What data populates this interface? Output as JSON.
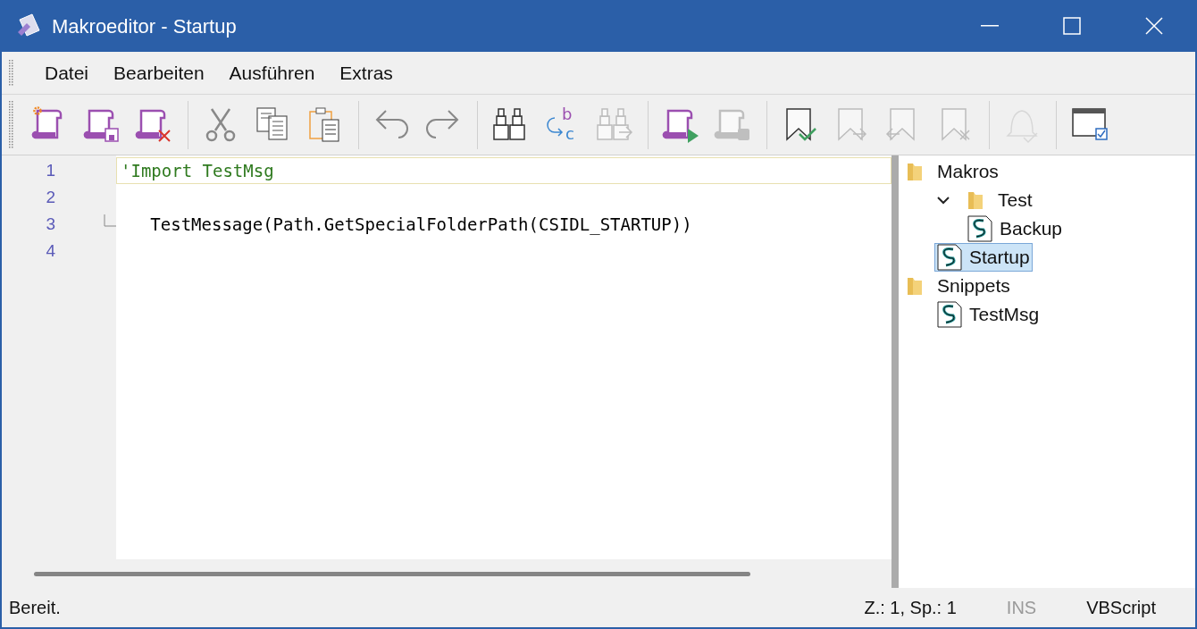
{
  "window": {
    "title": "Makroeditor - Startup"
  },
  "menu": [
    "Datei",
    "Bearbeiten",
    "Ausführen",
    "Extras"
  ],
  "toolbar": [
    {
      "kind": "new",
      "disabled": false
    },
    {
      "kind": "save",
      "disabled": false
    },
    {
      "kind": "delete",
      "disabled": false
    },
    {
      "kind": "sep"
    },
    {
      "kind": "cut",
      "disabled": false
    },
    {
      "kind": "copy",
      "disabled": false
    },
    {
      "kind": "paste",
      "disabled": false
    },
    {
      "kind": "sep"
    },
    {
      "kind": "undo",
      "disabled": false
    },
    {
      "kind": "redo",
      "disabled": false
    },
    {
      "kind": "sep"
    },
    {
      "kind": "find",
      "disabled": false
    },
    {
      "kind": "replace",
      "disabled": false,
      "letters": [
        "b",
        "c"
      ]
    },
    {
      "kind": "findnext",
      "disabled": true
    },
    {
      "kind": "sep"
    },
    {
      "kind": "run",
      "disabled": false
    },
    {
      "kind": "stop",
      "disabled": true
    },
    {
      "kind": "sep"
    },
    {
      "kind": "bookmark",
      "disabled": false
    },
    {
      "kind": "nextmark",
      "disabled": true
    },
    {
      "kind": "prevmark",
      "disabled": true
    },
    {
      "kind": "clearmarks",
      "disabled": true
    },
    {
      "kind": "sep"
    },
    {
      "kind": "bell",
      "disabled": true
    },
    {
      "kind": "sep"
    },
    {
      "kind": "window",
      "disabled": false
    }
  ],
  "editor": {
    "lines": [
      {
        "number": "1",
        "text": "'Import TestMsg",
        "kind": "comment",
        "current": true
      },
      {
        "number": "2"
      },
      {
        "number": "3",
        "text": "   TestMessage(Path.GetSpecialFolderPath(CSIDL_STARTUP))",
        "kind": "code",
        "fold_end": true
      },
      {
        "number": "4"
      }
    ]
  },
  "tree": [
    {
      "label": "Makros",
      "kind": "folder",
      "selected": false,
      "children": [
        {
          "label": "Test",
          "kind": "folder",
          "expanded": true,
          "selected": false,
          "children": [
            {
              "label": "Backup",
              "kind": "script",
              "selected": false
            }
          ]
        },
        {
          "label": "Startup",
          "kind": "script",
          "selected": true
        }
      ]
    },
    {
      "label": "Snippets",
      "kind": "folder",
      "selected": false,
      "children": [
        {
          "label": "TestMsg",
          "kind": "script",
          "selected": false
        }
      ]
    }
  ],
  "status_bar": {
    "message": "Bereit.",
    "position": "Z.: 1, Sp.: 1",
    "insert_mode": {
      "label": "INS",
      "active": false
    },
    "language": "VBScript"
  }
}
